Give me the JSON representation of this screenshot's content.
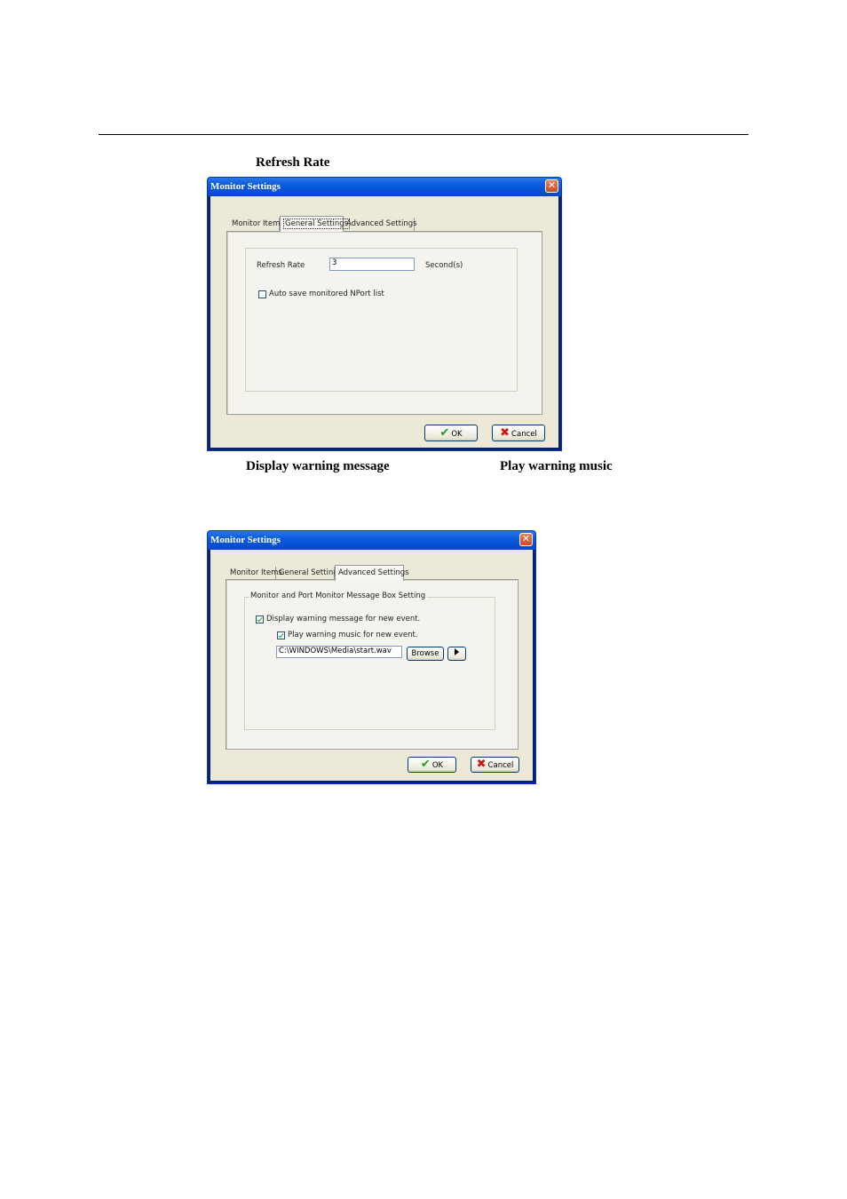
{
  "captions": {
    "refresh_rate": "Refresh Rate",
    "display_warning": "Display warning message",
    "play_warning": "Play warning music"
  },
  "dialog1": {
    "title": "Monitor Settings",
    "close_glyph": "✕",
    "tabs": [
      "Monitor Items",
      "General Settings",
      "Advanced Settings"
    ],
    "active_tab": "General Settings",
    "refresh_rate_label": "Refresh Rate",
    "refresh_rate_value": "3",
    "refresh_rate_unit": "Second(s)",
    "auto_save_label": "Auto save monitored NPort list",
    "auto_save_checked": false,
    "ok_label": "OK",
    "cancel_label": "Cancel"
  },
  "dialog2": {
    "title": "Monitor Settings",
    "close_glyph": "✕",
    "tabs": [
      "Monitor Items",
      "General Settings",
      "Advanced Settings"
    ],
    "active_tab": "Advanced Settings",
    "group_title": "Monitor and Port Monitor Message Box Setting",
    "display_warning_label": "Display warning message for new event.",
    "display_warning_checked": true,
    "play_music_label": "Play warning music for new event.",
    "play_music_checked": true,
    "music_path": "C:\\WINDOWS\\Media\\start.wav",
    "browse_label": "Browse",
    "ok_label": "OK",
    "cancel_label": "Cancel"
  },
  "icons": {
    "ok": "check-icon",
    "cancel": "x-icon",
    "play": "play-icon",
    "close": "close-icon"
  }
}
